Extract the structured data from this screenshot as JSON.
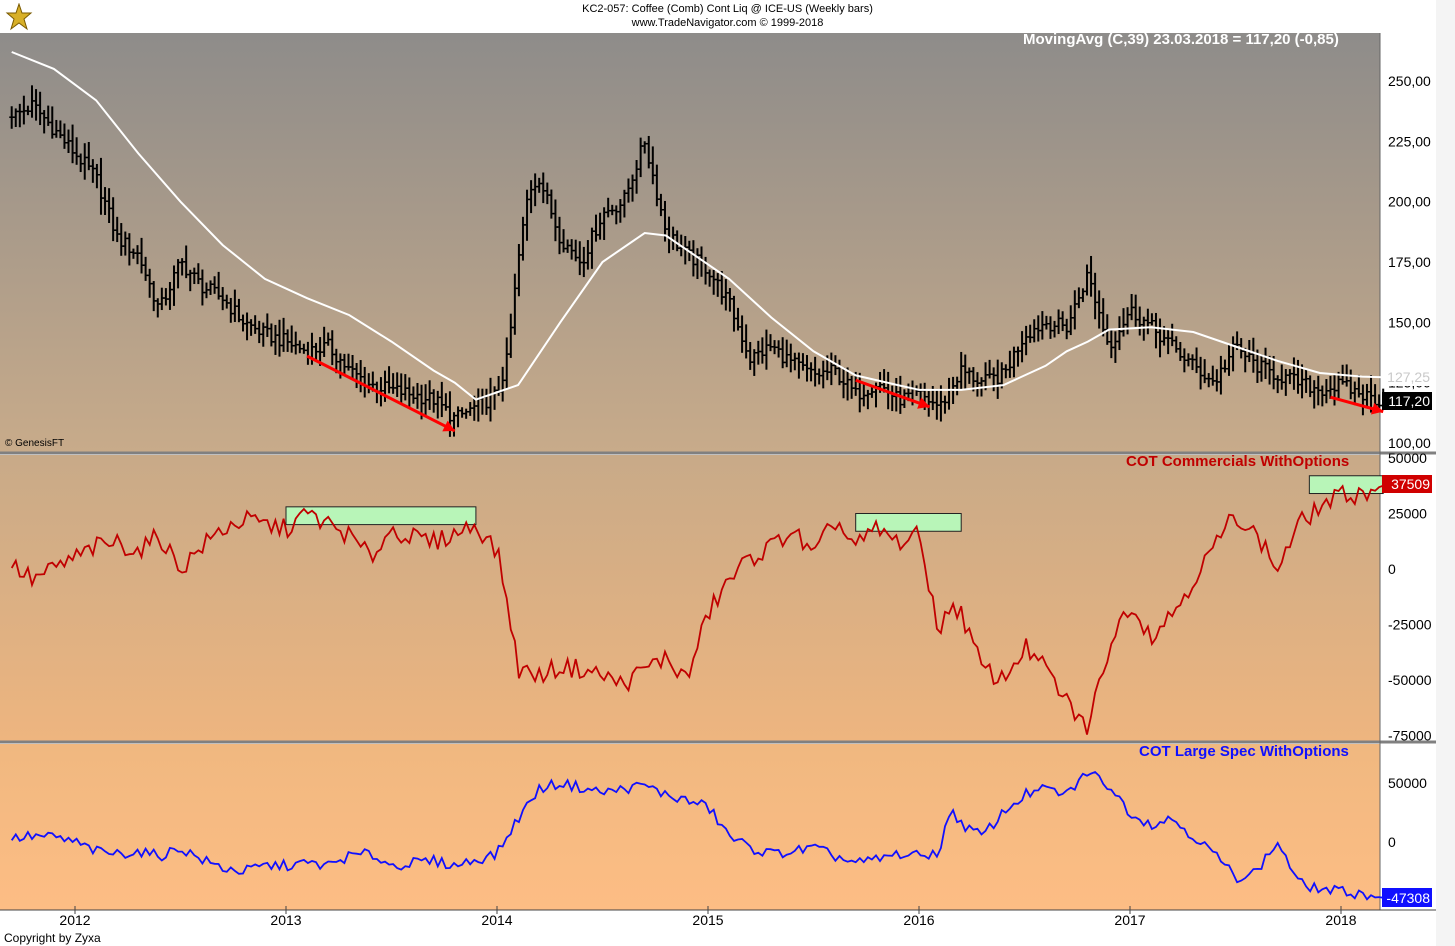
{
  "header": {
    "line1": "KC2-057:  Coffee (Comb) Cont Liq @ ICE-US  (Weekly bars)",
    "line2": "www.TradeNavigator.com © 1999-2018"
  },
  "footer": {
    "copyright": "Copyright by Zyxa"
  },
  "price_panel": {
    "ma_label": "MovingAvg (C,39)   23.03.2018 = 117,20 (-0,85)",
    "source_label": "© GenesisFT",
    "ma_value_label": "127,25",
    "last_value_label": "117,20"
  },
  "commercials_panel": {
    "title": "COT Commercials WithOptions",
    "last_value_label": "37509"
  },
  "spec_panel": {
    "title": "COT Large Spec WithOptions",
    "last_value_label": "-47308"
  },
  "colors": {
    "price_bars": "#000000",
    "moving_average": "#ffffff",
    "commercials_line": "#c00000",
    "spec_line": "#1010ff",
    "arrows": "#ff0000",
    "highlight_boxes": "#b8f5b8"
  },
  "chart_data": [
    {
      "type": "ohlc",
      "panel": "price",
      "yticks": [
        "250,00",
        "225,00",
        "200,00",
        "175,00",
        "150,00",
        "125,00",
        "100,00"
      ],
      "ylim": [
        100,
        250
      ],
      "xticks": [
        "2012",
        "2013",
        "2014",
        "2015",
        "2016",
        "2017",
        "2018"
      ],
      "series": [
        {
          "name": "Coffee close (weekly, approx.)",
          "x": [
            2011.7,
            2011.8,
            2011.9,
            2012.0,
            2012.1,
            2012.2,
            2012.3,
            2012.4,
            2012.5,
            2012.6,
            2012.7,
            2012.8,
            2012.9,
            2013.0,
            2013.1,
            2013.2,
            2013.3,
            2013.4,
            2013.5,
            2013.6,
            2013.7,
            2013.8,
            2013.9,
            2014.0,
            2014.05,
            2014.1,
            2014.15,
            2014.2,
            2014.3,
            2014.4,
            2014.5,
            2014.6,
            2014.7,
            2014.8,
            2014.9,
            2015.0,
            2015.1,
            2015.2,
            2015.3,
            2015.4,
            2015.5,
            2015.6,
            2015.7,
            2015.8,
            2015.9,
            2016.0,
            2016.1,
            2016.2,
            2016.3,
            2016.4,
            2016.5,
            2016.6,
            2016.7,
            2016.8,
            2016.9,
            2017.0,
            2017.1,
            2017.2,
            2017.3,
            2017.4,
            2017.5,
            2017.6,
            2017.7,
            2017.8,
            2017.9,
            2018.0,
            2018.1,
            2018.2
          ],
          "values": [
            235,
            240,
            230,
            220,
            210,
            185,
            178,
            155,
            175,
            165,
            160,
            150,
            145,
            142,
            138,
            140,
            130,
            124,
            122,
            120,
            118,
            110,
            115,
            120,
            135,
            175,
            205,
            210,
            185,
            175,
            195,
            200,
            225,
            188,
            178,
            172,
            158,
            135,
            140,
            133,
            128,
            130,
            120,
            125,
            118,
            120,
            115,
            130,
            125,
            128,
            145,
            150,
            148,
            170,
            140,
            155,
            148,
            140,
            132,
            125,
            140,
            132,
            128,
            125,
            122,
            124,
            120,
            117.2
          ]
        },
        {
          "name": "MovingAvg (C,39)",
          "x": [
            2011.7,
            2011.9,
            2012.1,
            2012.3,
            2012.5,
            2012.7,
            2012.9,
            2013.1,
            2013.3,
            2013.5,
            2013.7,
            2013.8,
            2013.9,
            2014.1,
            2014.3,
            2014.5,
            2014.7,
            2014.8,
            2014.9,
            2015.1,
            2015.3,
            2015.5,
            2015.7,
            2015.9,
            2016.0,
            2016.2,
            2016.4,
            2016.6,
            2016.7,
            2016.8,
            2016.9,
            2017.1,
            2017.3,
            2017.5,
            2017.7,
            2017.9,
            2018.1,
            2018.2
          ],
          "values": [
            262,
            255,
            242,
            220,
            200,
            182,
            168,
            160,
            153,
            142,
            130,
            125,
            118,
            124,
            150,
            175,
            187,
            186,
            180,
            168,
            152,
            138,
            128,
            124,
            122,
            122,
            124,
            132,
            138,
            142,
            147,
            148,
            146,
            140,
            134,
            129,
            127.5,
            127.25
          ]
        }
      ]
    },
    {
      "type": "line",
      "panel": "commercials",
      "yticks": [
        "50000",
        "25000",
        "0",
        "-25000",
        "-50000",
        "-75000"
      ],
      "ylim": [
        -75000,
        50000
      ],
      "series": [
        {
          "name": "COT Commercials WithOptions",
          "x": [
            2011.7,
            2011.8,
            2011.9,
            2012.0,
            2012.1,
            2012.2,
            2012.3,
            2012.4,
            2012.5,
            2012.6,
            2012.7,
            2012.8,
            2012.9,
            2013.0,
            2013.1,
            2013.2,
            2013.3,
            2013.4,
            2013.5,
            2013.6,
            2013.7,
            2013.8,
            2013.9,
            2014.0,
            2014.05,
            2014.1,
            2014.2,
            2014.3,
            2014.4,
            2014.5,
            2014.6,
            2014.7,
            2014.8,
            2014.9,
            2015.0,
            2015.1,
            2015.2,
            2015.3,
            2015.4,
            2015.5,
            2015.6,
            2015.7,
            2015.8,
            2015.9,
            2016.0,
            2016.1,
            2016.15,
            2016.2,
            2016.3,
            2016.4,
            2016.5,
            2016.6,
            2016.7,
            2016.8,
            2016.9,
            2017.0,
            2017.1,
            2017.2,
            2017.3,
            2017.4,
            2017.5,
            2017.6,
            2017.7,
            2017.8,
            2017.9,
            2018.0,
            2018.1,
            2018.2
          ],
          "values": [
            2000,
            -5000,
            0,
            5000,
            10000,
            12000,
            8000,
            15000,
            0,
            10000,
            18000,
            22000,
            20000,
            18000,
            25000,
            20000,
            15000,
            5000,
            18000,
            14000,
            12000,
            16000,
            20000,
            8000,
            -15000,
            -45000,
            -48000,
            -44000,
            -45000,
            -48000,
            -52000,
            -45000,
            -40000,
            -50000,
            -20000,
            -5000,
            5000,
            10000,
            18000,
            5000,
            22000,
            10000,
            18000,
            12000,
            15000,
            -30000,
            -15000,
            -20000,
            -45000,
            -50000,
            -35000,
            -45000,
            -60000,
            -72000,
            -35000,
            -15000,
            -30000,
            -20000,
            -5000,
            10000,
            25000,
            15000,
            0,
            20000,
            28000,
            33000,
            34000,
            37509
          ]
        }
      ],
      "highlights": [
        {
          "x": [
            2013.0,
            2013.9
          ],
          "y": [
            20000,
            28000
          ]
        },
        {
          "x": [
            2015.7,
            2016.2
          ],
          "y": [
            17000,
            25000
          ]
        },
        {
          "x": [
            2017.85,
            2018.2
          ],
          "y": [
            34000,
            42000
          ]
        }
      ]
    },
    {
      "type": "line",
      "panel": "large_spec",
      "yticks": [
        "50000",
        "0"
      ],
      "ylim": [
        -55000,
        80000
      ],
      "xticks": [
        "2012",
        "2013",
        "2014",
        "2015",
        "2016",
        "2017",
        "2018"
      ],
      "series": [
        {
          "name": "COT Large Spec WithOptions",
          "x": [
            2011.7,
            2011.8,
            2011.9,
            2012.0,
            2012.1,
            2012.2,
            2012.3,
            2012.4,
            2012.5,
            2012.6,
            2012.7,
            2012.8,
            2012.9,
            2013.0,
            2013.1,
            2013.2,
            2013.3,
            2013.4,
            2013.5,
            2013.6,
            2013.7,
            2013.8,
            2013.9,
            2014.0,
            2014.1,
            2014.2,
            2014.3,
            2014.4,
            2014.5,
            2014.6,
            2014.7,
            2014.8,
            2014.9,
            2015.0,
            2015.1,
            2015.2,
            2015.3,
            2015.4,
            2015.5,
            2015.6,
            2015.7,
            2015.8,
            2015.9,
            2016.0,
            2016.1,
            2016.15,
            2016.2,
            2016.3,
            2016.4,
            2016.5,
            2016.6,
            2016.7,
            2016.8,
            2016.9,
            2017.0,
            2017.1,
            2017.2,
            2017.3,
            2017.4,
            2017.5,
            2017.6,
            2017.7,
            2017.8,
            2017.9,
            2018.0,
            2018.1,
            2018.2
          ],
          "values": [
            3000,
            5000,
            4000,
            0,
            -8000,
            -10000,
            -8000,
            -12000,
            -5000,
            -15000,
            -22000,
            -25000,
            -20000,
            -20000,
            -18000,
            -20000,
            -12000,
            -10000,
            -20000,
            -18000,
            -16000,
            -20000,
            -15000,
            -10000,
            20000,
            45000,
            50000,
            46000,
            42000,
            45000,
            48000,
            40000,
            35000,
            30000,
            5000,
            -5000,
            -10000,
            -8000,
            -5000,
            -12000,
            -18000,
            -15000,
            -10000,
            -12000,
            -8000,
            30000,
            15000,
            5000,
            25000,
            40000,
            45000,
            40000,
            60000,
            48000,
            25000,
            15000,
            20000,
            5000,
            -10000,
            -30000,
            -25000,
            0,
            -35000,
            -40000,
            -42000,
            -44000,
            -47308
          ]
        }
      ]
    }
  ]
}
